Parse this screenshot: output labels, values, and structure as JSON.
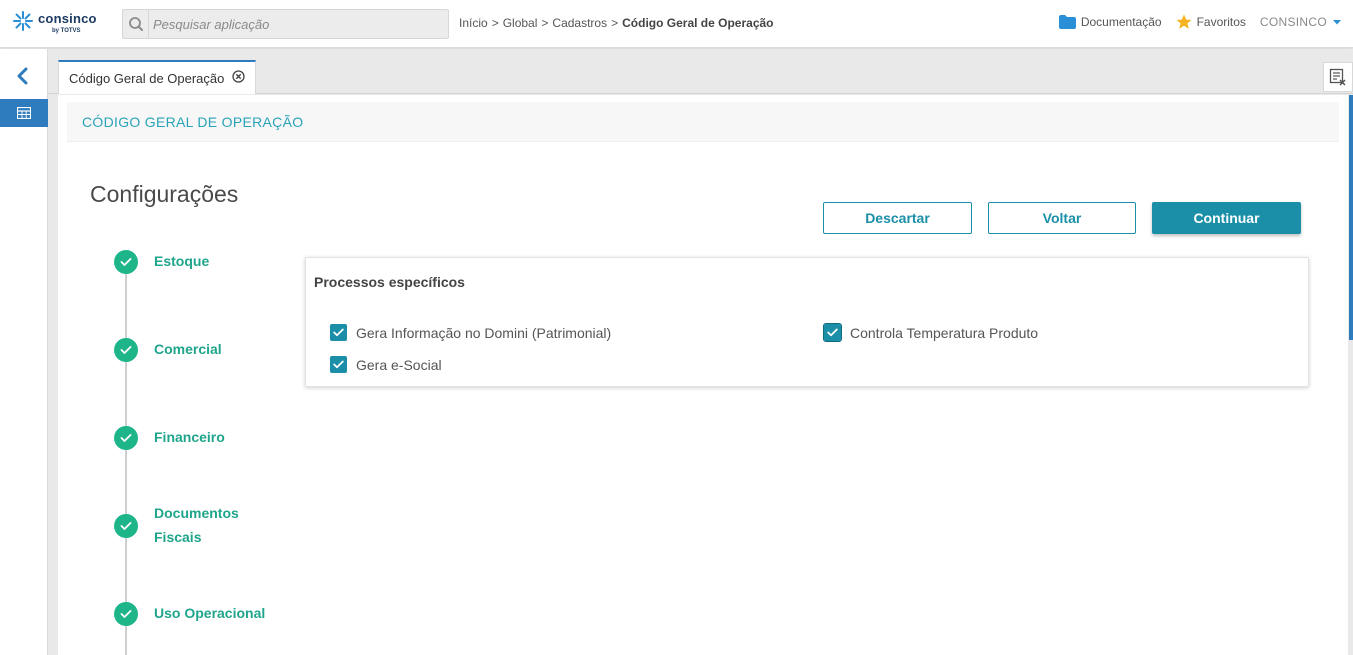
{
  "header": {
    "logo_text": "consinco",
    "logo_sub": "by TOTVS",
    "search_placeholder": "Pesquisar aplicação",
    "breadcrumb": [
      "Início",
      "Global",
      "Cadastros"
    ],
    "breadcrumb_separator": ">",
    "breadcrumb_current": "Código Geral de Operação",
    "documentation_label": "Documentação",
    "favorites_label": "Favoritos",
    "user_label": "CONSINCO"
  },
  "tabs": [
    {
      "label": "Código Geral de Operação",
      "active": true
    }
  ],
  "page": {
    "header_title": "CÓDIGO GERAL DE OPERAÇÃO",
    "section_title": "Configurações",
    "buttons": {
      "discard": "Descartar",
      "back": "Voltar",
      "continue": "Continuar"
    }
  },
  "steps": [
    {
      "label": "Estoque",
      "done": true
    },
    {
      "label": "Comercial",
      "done": true
    },
    {
      "label": "Financeiro",
      "done": true
    },
    {
      "label": "Documentos Fiscais",
      "done": true
    },
    {
      "label": "Uso Operacional",
      "done": true
    }
  ],
  "panel": {
    "title": "Processos específicos",
    "checkboxes": [
      {
        "label": "Gera Informação no Domini (Patrimonial)",
        "checked": true
      },
      {
        "label": "Controla Temperatura Produto",
        "checked": true
      },
      {
        "label": "Gera e-Social",
        "checked": true
      }
    ]
  },
  "colors": {
    "accent": "#1b8fa7",
    "step_green": "#1fb58a",
    "header_text": "#29a3b8",
    "rail_active": "#2e7bbd",
    "favorite_star": "#f5b324",
    "folder_blue": "#2a8fd6"
  }
}
